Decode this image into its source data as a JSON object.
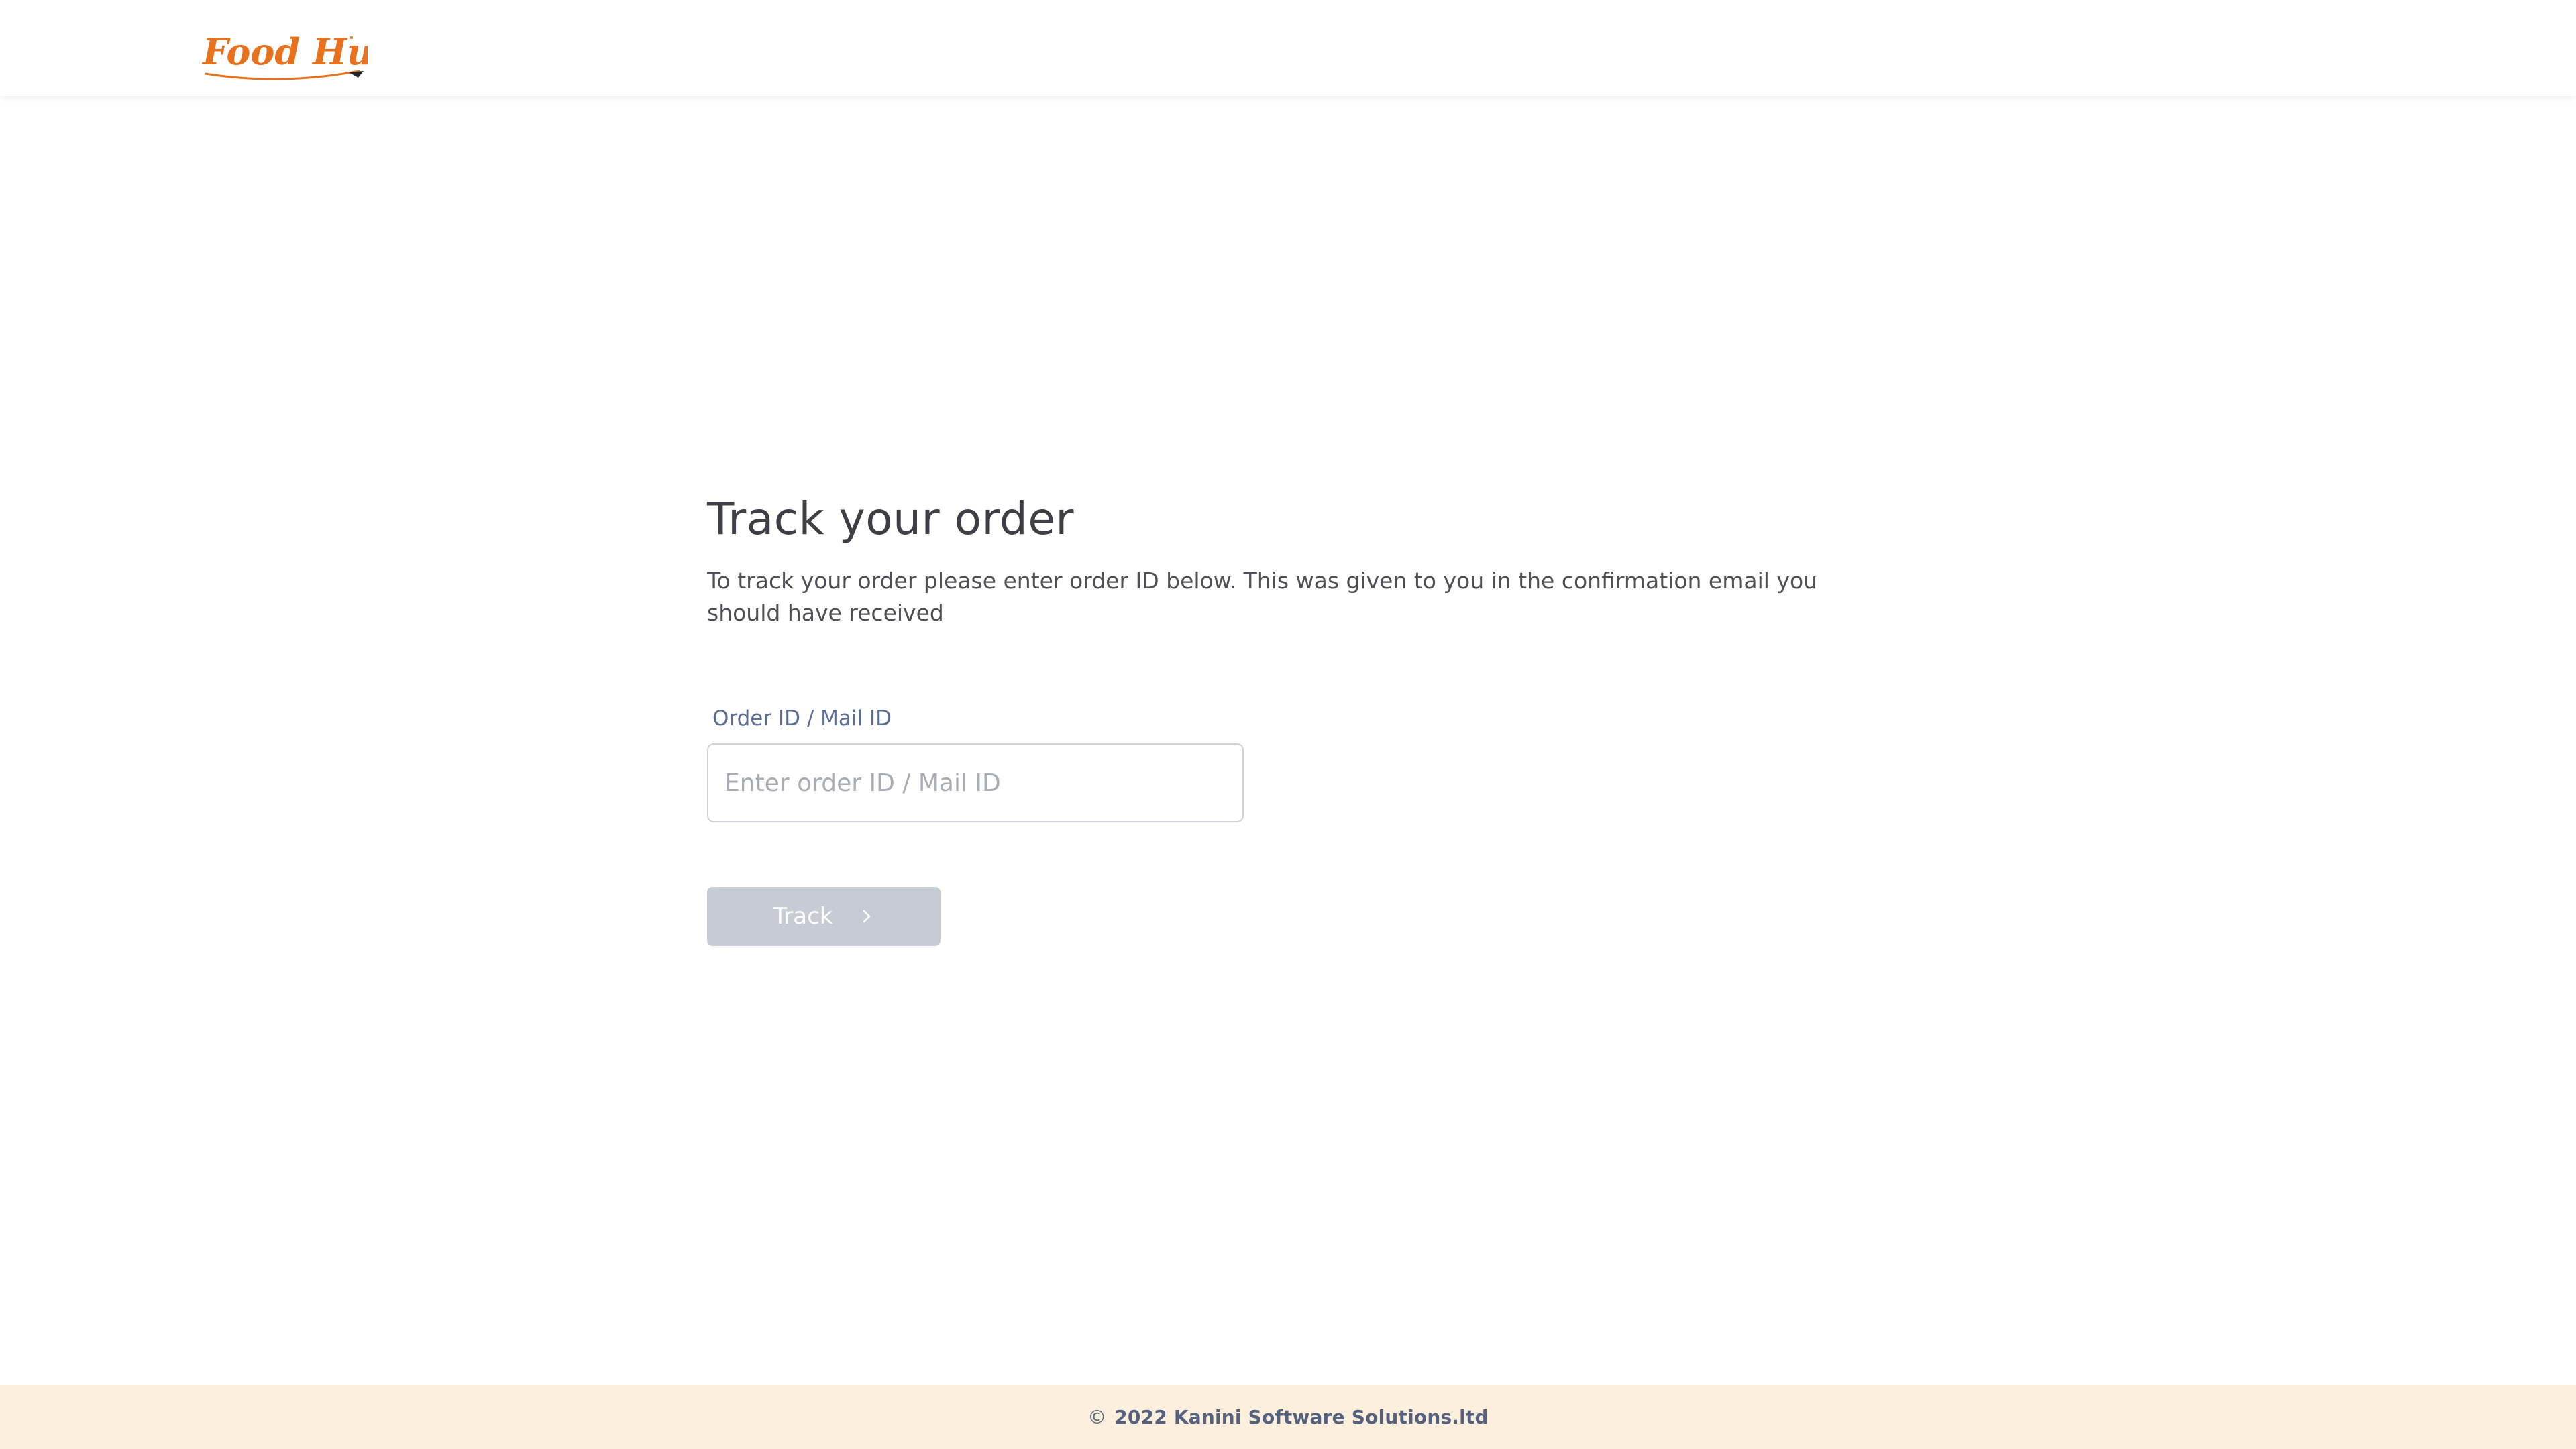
{
  "header": {
    "logo_text": "Food Hut"
  },
  "main": {
    "title": "Track your order",
    "description": "To track your order please enter order ID below. This was given to you  in the confirmation email you should have received",
    "field_label": "Order ID / Mail ID",
    "input_value": "",
    "input_placeholder": "Enter order ID / Mail ID",
    "button_label": "Track",
    "button_icon": "chevron-right-icon"
  },
  "footer": {
    "copyright_symbol": "©",
    "text": "2022 Kanini Software Solutions.ltd"
  },
  "colors": {
    "brand": "#e8711d",
    "button_disabled": "#c6cbd4",
    "label": "#5a6d94",
    "footer_bg": "#fdefdd"
  }
}
